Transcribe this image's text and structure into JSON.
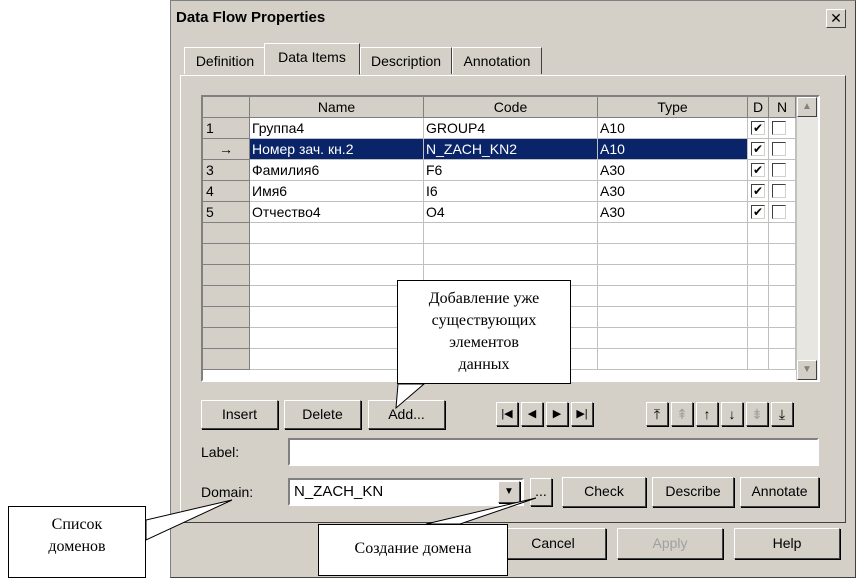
{
  "window": {
    "title": "Data Flow Properties",
    "close_glyph": "✕"
  },
  "tabs": [
    {
      "label": "Definition"
    },
    {
      "label": "Data Items"
    },
    {
      "label": "Description"
    },
    {
      "label": "Annotation"
    }
  ],
  "grid": {
    "columns": {
      "name": "Name",
      "code": "Code",
      "type": "Type",
      "d": "D",
      "n": "N"
    },
    "rows": [
      {
        "num": "1",
        "name": "Группа4",
        "code": "GROUP4",
        "type": "A10",
        "d": true,
        "n": false
      },
      {
        "num": "→",
        "name": "Номер зач. кн.2",
        "code": "N_ZACH_KN2",
        "type": "A10",
        "d": true,
        "n": false
      },
      {
        "num": "3",
        "name": "Фамилия6",
        "code": "F6",
        "type": "A30",
        "d": true,
        "n": false
      },
      {
        "num": "4",
        "name": "Имя6",
        "code": "I6",
        "type": "A30",
        "d": true,
        "n": false
      },
      {
        "num": "5",
        "name": "Отчество4",
        "code": "O4",
        "type": "A30",
        "d": true,
        "n": false
      }
    ],
    "check_glyph": "✔",
    "scroll_up_glyph": "▲",
    "scroll_down_glyph": "▼"
  },
  "buttons": {
    "insert": "Insert",
    "delete": "Delete",
    "add": "Add...",
    "check": "Check",
    "describe": "Describe",
    "annotate": "Annotate",
    "cancel": "Cancel",
    "apply": "Apply",
    "help": "Help",
    "browse": "..."
  },
  "nav_glyphs": {
    "first": "|◀",
    "prev": "◀",
    "next": "▶",
    "last": "▶|"
  },
  "move_glyphs": {
    "top": "⤒",
    "up_page": "⇞",
    "up": "↑",
    "down": "↓",
    "down_page": "⇟",
    "bottom": "⤓"
  },
  "fields": {
    "label_caption": "Label:",
    "label_value": "",
    "domain_caption": "Domain:",
    "domain_value": "N_ZACH_KN",
    "dropdown_glyph": "▼"
  },
  "callouts": {
    "add_existing": [
      "Добавление уже",
      "существующих",
      "элементов",
      "данных"
    ],
    "domain_list": [
      "Список",
      "доменов"
    ],
    "domain_create": "Создание домена"
  }
}
